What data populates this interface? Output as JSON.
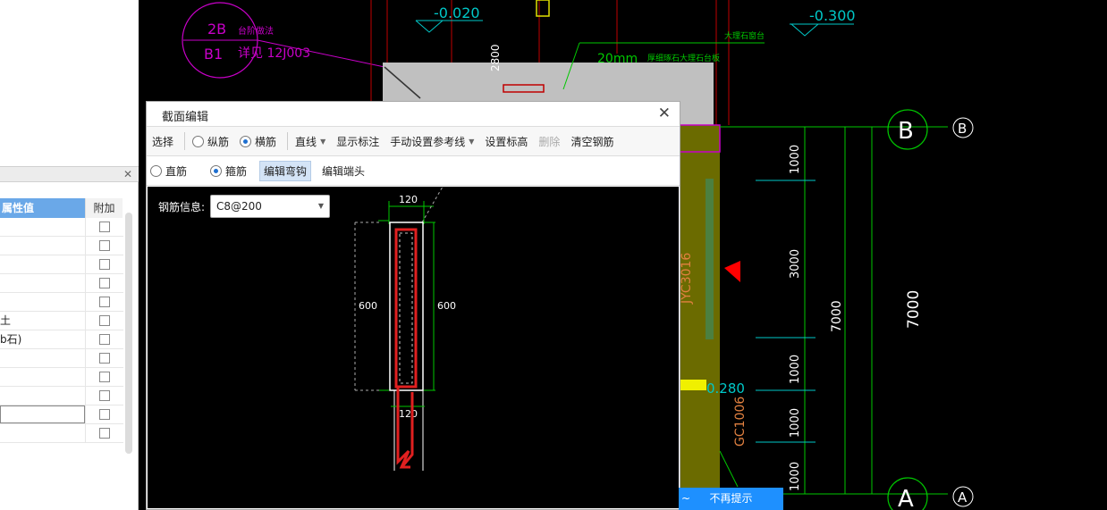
{
  "dialog": {
    "title": "截面编辑",
    "close": "✕",
    "toolbar": {
      "select": "选择",
      "radio_longitudinal": "纵筋",
      "radio_transverse": "横筋",
      "line": "直线",
      "show_annotation": "显示标注",
      "manual_ref_line": "手动设置参考线",
      "set_elevation": "设置标高",
      "delete": "删除",
      "clear_rebar": "清空钢筋"
    },
    "toolbar2": {
      "radio_straight": "直筋",
      "radio_stirrup": "箍筋",
      "edit_hook": "编辑弯钩",
      "edit_end": "编辑端头"
    },
    "rebar_info_label": "钢筋信息:",
    "rebar_info_value": "C8@200",
    "dims": {
      "top": "120",
      "bottom": "120",
      "left": "600",
      "right": "600"
    }
  },
  "left_panel": {
    "col_value": "属性值",
    "col_extra": "附加",
    "rows": [
      "",
      "",
      "",
      "",
      "",
      "土",
      "b石)",
      "",
      "",
      "",
      "",
      ""
    ]
  },
  "cad": {
    "elev1": "-0.020",
    "elev2": "-0.300",
    "callout_top": "2B",
    "callout_bot": "B1",
    "note1": "台阶做法",
    "note2": "详见  12J003",
    "note3": "大理石窗台",
    "note4": "20mm",
    "note5": "厚细琢石大理石台板",
    "dim_2800": "2800",
    "axis_b": "B",
    "axis_a": "A",
    "dim_1000a": "1000",
    "dim_3000": "3000",
    "dim_1000b": "1000",
    "dim_1000c": "1000",
    "dim_1000d": "1000",
    "dim_7000a": "7000",
    "dim_7000b": "7000",
    "label_jyc": "JYC3016",
    "label_gc": "GC1006",
    "elev3": "0.280"
  },
  "tip": {
    "label": "不再提示",
    "tilde": "~"
  },
  "colors": {
    "accent": "#1e90ff",
    "cad_green": "#00c800",
    "cad_magenta": "#c800c8",
    "cad_cyan": "#00c8c8",
    "rebar_red": "#e02020"
  }
}
